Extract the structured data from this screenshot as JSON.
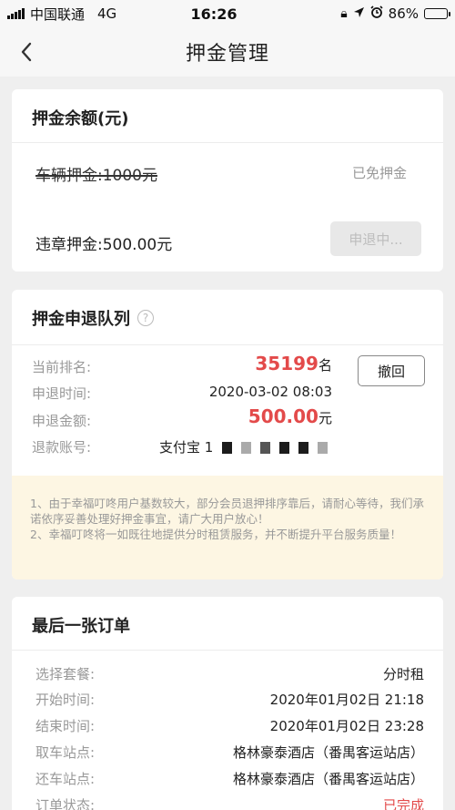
{
  "status_bar": {
    "carrier": "中国联通",
    "network": "4G",
    "time": "16:26",
    "battery": "86%",
    "battery_level": 0.86
  },
  "nav": {
    "title": "押金管理"
  },
  "balance": {
    "title": "押金余额(元)",
    "vehicle_deposit_label": "车辆押金:1000元",
    "vehicle_deposit_status": "已免押金",
    "violation_deposit_label": "违章押金:500.00元",
    "refund_button": "申退中..."
  },
  "queue": {
    "title": "押金申退队列",
    "rank_label": "当前排名:",
    "rank_value": "35199",
    "rank_unit": "名",
    "revoke_button": "撤回",
    "time_label": "申退时间:",
    "time_value": "2020-03-02 08:03",
    "amount_label": "申退金额:",
    "amount_value": "500.00",
    "amount_unit": "元",
    "account_label": "退款账号:",
    "account_value": "支付宝 1",
    "notice_1": "1、由于幸福叮咚用户基数较大，部分会员退押排序靠后，请耐心等待，我们承诺依序妥善处理好押金事宜，请广大用户放心！",
    "notice_2": "2、幸福叮咚将一如既往地提供分时租赁服务，并不断提升平台服务质量！"
  },
  "last_order": {
    "title": "最后一张订单",
    "package_label": "选择套餐:",
    "package_value": "分时租",
    "start_label": "开始时间:",
    "start_value": "2020年01月02日 21:18",
    "end_label": "结束时间:",
    "end_value": "2020年01月02日 23:28",
    "pickup_label": "取车站点:",
    "pickup_value": "格林豪泰酒店（番禺客运站店）",
    "return_label": "还车站点:",
    "return_value": "格林豪泰酒店（番禺客运站店）",
    "state_label": "订单状态:",
    "state_value": "已完成"
  }
}
